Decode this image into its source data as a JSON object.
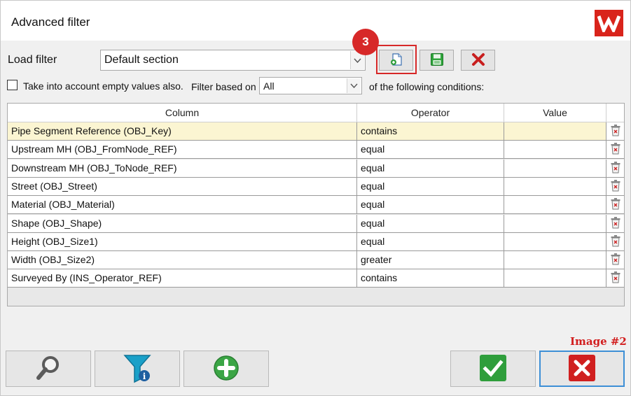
{
  "window": {
    "title": "Advanced filter",
    "logo_icon": "w-logo-icon"
  },
  "load_filter": {
    "label": "Load filter",
    "selected": "Default section",
    "buttons": [
      {
        "name": "new-filter-button",
        "icon": "new-document-icon"
      },
      {
        "name": "save-filter-button",
        "icon": "save-icon"
      },
      {
        "name": "delete-filter-button",
        "icon": "red-x-icon"
      }
    ]
  },
  "annotation": {
    "step_badge": "3",
    "image_tag": "Image #2",
    "color": "#d72828"
  },
  "options": {
    "empty_values_label": "Take into account empty values also.",
    "empty_values_checked": false,
    "filter_based_label": "Filter based on",
    "filter_based_value": "All",
    "conditions_suffix": "of the following conditions:"
  },
  "grid": {
    "headers": [
      "Column",
      "Operator",
      "Value"
    ],
    "rows": [
      {
        "column": "Pipe Segment Reference (OBJ_Key)",
        "operator": "contains",
        "value": ""
      },
      {
        "column": "Upstream MH (OBJ_FromNode_REF)",
        "operator": "equal",
        "value": ""
      },
      {
        "column": "Downstream MH (OBJ_ToNode_REF)",
        "operator": "equal",
        "value": ""
      },
      {
        "column": "Street (OBJ_Street)",
        "operator": "equal",
        "value": ""
      },
      {
        "column": "Material (OBJ_Material)",
        "operator": "equal",
        "value": ""
      },
      {
        "column": "Shape (OBJ_Shape)",
        "operator": "equal",
        "value": ""
      },
      {
        "column": "Height (OBJ_Size1)",
        "operator": "equal",
        "value": ""
      },
      {
        "column": "Width (OBJ_Size2)",
        "operator": "greater",
        "value": ""
      },
      {
        "column": "Surveyed By (INS_Operator_REF)",
        "operator": "contains",
        "value": ""
      }
    ],
    "selected_row": 0,
    "row_delete_icon": "trash-icon"
  },
  "bottom_buttons": [
    {
      "name": "search-button",
      "icon": "magnifier-icon"
    },
    {
      "name": "filter-info-button",
      "icon": "filter-info-icon"
    },
    {
      "name": "add-condition-button",
      "icon": "green-plus-icon"
    },
    {
      "name": "ok-button",
      "icon": "green-check-icon"
    },
    {
      "name": "cancel-button",
      "icon": "red-x-icon"
    }
  ],
  "colors": {
    "accent_red": "#d72828",
    "selected_row": "#fbf5d2",
    "ok_green": "#2f9e3c",
    "focus_blue": "#3d8fd6"
  }
}
